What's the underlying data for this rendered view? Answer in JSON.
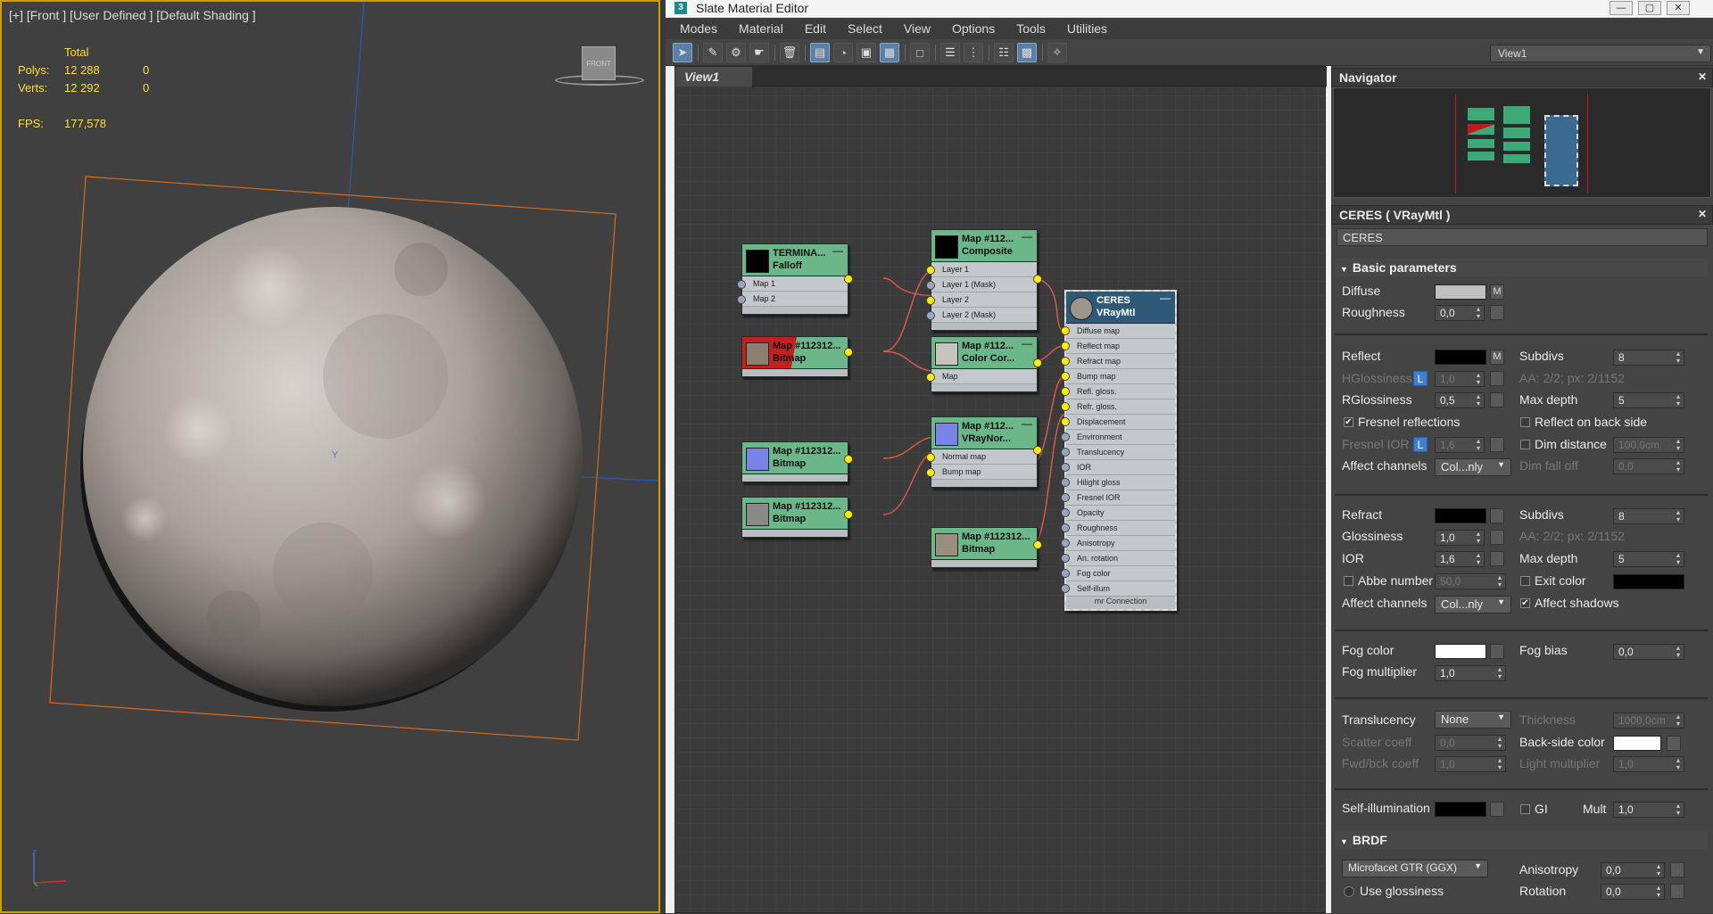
{
  "viewport": {
    "label": "[+] [Front ] [User Defined ] [Default Shading ]",
    "stats": {
      "total_label": "Total",
      "polys_label": "Polys:",
      "polys_total": "12 288",
      "polys_sel": "0",
      "verts_label": "Verts:",
      "verts_total": "12 292",
      "verts_sel": "0",
      "fps_label": "FPS:",
      "fps_value": "177,578"
    },
    "viewcube_label": "FRONT",
    "gizmo_label": "Y"
  },
  "window": {
    "title": "Slate Material Editor",
    "icon": "3",
    "minimize": "—",
    "maximize": "▢",
    "close": "✕"
  },
  "menu": [
    "Modes",
    "Material",
    "Edit",
    "Select",
    "View",
    "Options",
    "Tools",
    "Utilities"
  ],
  "toolbar": {
    "view_select": "View1"
  },
  "view": {
    "tab": "View1"
  },
  "nodes": {
    "falloff": {
      "title1": "TERMINA...",
      "title2": "Falloff",
      "rows": [
        "Map 1",
        "Map 2"
      ]
    },
    "composite": {
      "title1": "Map #112...",
      "title2": "Composite",
      "rows": [
        "Layer 1",
        "Layer 1 (Mask)",
        "Layer 2",
        "Layer 2 (Mask)"
      ]
    },
    "bitmap1": {
      "title1": "Map #112312...",
      "title2": "Bitmap"
    },
    "colorcor": {
      "title1": "Map #112...",
      "title2": "Color Cor...",
      "rows": [
        "Map"
      ]
    },
    "bitmap2": {
      "title1": "Map #112312...",
      "title2": "Bitmap"
    },
    "vraynormal": {
      "title1": "Map #112...",
      "title2": "VRayNor...",
      "rows": [
        "Normal map",
        "Bump map"
      ]
    },
    "bitmap3": {
      "title1": "Map #112312...",
      "title2": "Bitmap"
    },
    "bitmap4": {
      "title1": "Map #112312...",
      "title2": "Bitmap"
    },
    "ceres": {
      "title1": "CERES",
      "title2": "VRayMtl",
      "rows": [
        "Diffuse map",
        "Reflect map",
        "Refract map",
        "Bump map",
        "Refl. gloss.",
        "Refr. gloss.",
        "Displacement",
        "Environment",
        "Translucency",
        "IOR",
        "Hilight gloss",
        "Fresnel IOR",
        "Opacity",
        "Roughness",
        "Anisotropy",
        "An. rotation",
        "Fog color",
        "Self-illum"
      ],
      "footer": "mr Connection"
    }
  },
  "navigator": {
    "title": "Navigator",
    "close": "✕"
  },
  "material": {
    "header": "CERES  ( VRayMtl )",
    "close": "✕",
    "name": "CERES",
    "basic_title": "Basic parameters",
    "diffuse_label": "Diffuse",
    "m_label": "M",
    "roughness_label": "Roughness",
    "roughness_value": "0,0",
    "reflect_label": "Reflect",
    "subdivs_label": "Subdivs",
    "refl_subdivs": "8",
    "hgloss_label": "HGlossiness",
    "l_label": "L",
    "hgloss_value": "1,0",
    "aa_refl": "AA: 2/2; px: 2/1152",
    "rgloss_label": "RGlossiness",
    "rgloss_value": "0,5",
    "maxdepth_label": "Max depth",
    "refl_maxdepth": "5",
    "fresnel_label": "Fresnel reflections",
    "check": "✔",
    "reflect_back_label": "Reflect on back side",
    "fresnel_ior_label": "Fresnel IOR",
    "fresnel_ior_value": "1,6",
    "dim_distance_label": "Dim distance",
    "dim_distance_value": "100,0cm",
    "affect_channels_label": "Affect channels",
    "affect_channels_value": "Col...nly",
    "dim_falloff_label": "Dim fall off",
    "dim_falloff_value": "0,0",
    "refract_label": "Refract",
    "refr_subdivs": "8",
    "aa_refr": "AA: 2/2; px: 2/1152",
    "glossiness_label": "Glossiness",
    "glossiness_value": "1,0",
    "ior_label": "IOR",
    "ior_value": "1,6",
    "refr_maxdepth": "5",
    "abbe_label": "Abbe number",
    "abbe_value": "50,0",
    "exit_color_label": "Exit color",
    "affect_channels2_value": "Col...nly",
    "affect_shadows_label": "Affect shadows",
    "fog_color_label": "Fog color",
    "fog_bias_label": "Fog bias",
    "fog_bias_value": "0,0",
    "fog_mult_label": "Fog multiplier",
    "fog_mult_value": "1,0",
    "translucency_label": "Translucency",
    "translucency_value": "None",
    "thickness_label": "Thickness",
    "thickness_value": "1000,0cm",
    "scatter_label": "Scatter coeff",
    "scatter_value": "0,0",
    "backside_label": "Back-side color",
    "fwdbck_label": "Fwd/bck coeff",
    "fwdbck_value": "1,0",
    "lightmult_label": "Light multiplier",
    "lightmult_value": "1,0",
    "selfillum_label": "Self-illumination",
    "gi_label": "GI",
    "mult_label": "Mult",
    "mult_value": "1,0",
    "brdf_title": "BRDF",
    "brdf_type": "Microfacet GTR (GGX)",
    "anisotropy_label": "Anisotropy",
    "anisotropy_value": "0,0",
    "use_gloss_label": "Use glossiness",
    "rotation_label": "Rotation",
    "rotation_value": "0,0"
  },
  "colors": {
    "diffuse": "#c0c0c0",
    "reflect": "#000000",
    "refract": "#000000",
    "exit": "#000000",
    "fog": "#ffffff",
    "backside": "#ffffff",
    "selfillum": "#000000",
    "accent_select": "#c8a000"
  }
}
